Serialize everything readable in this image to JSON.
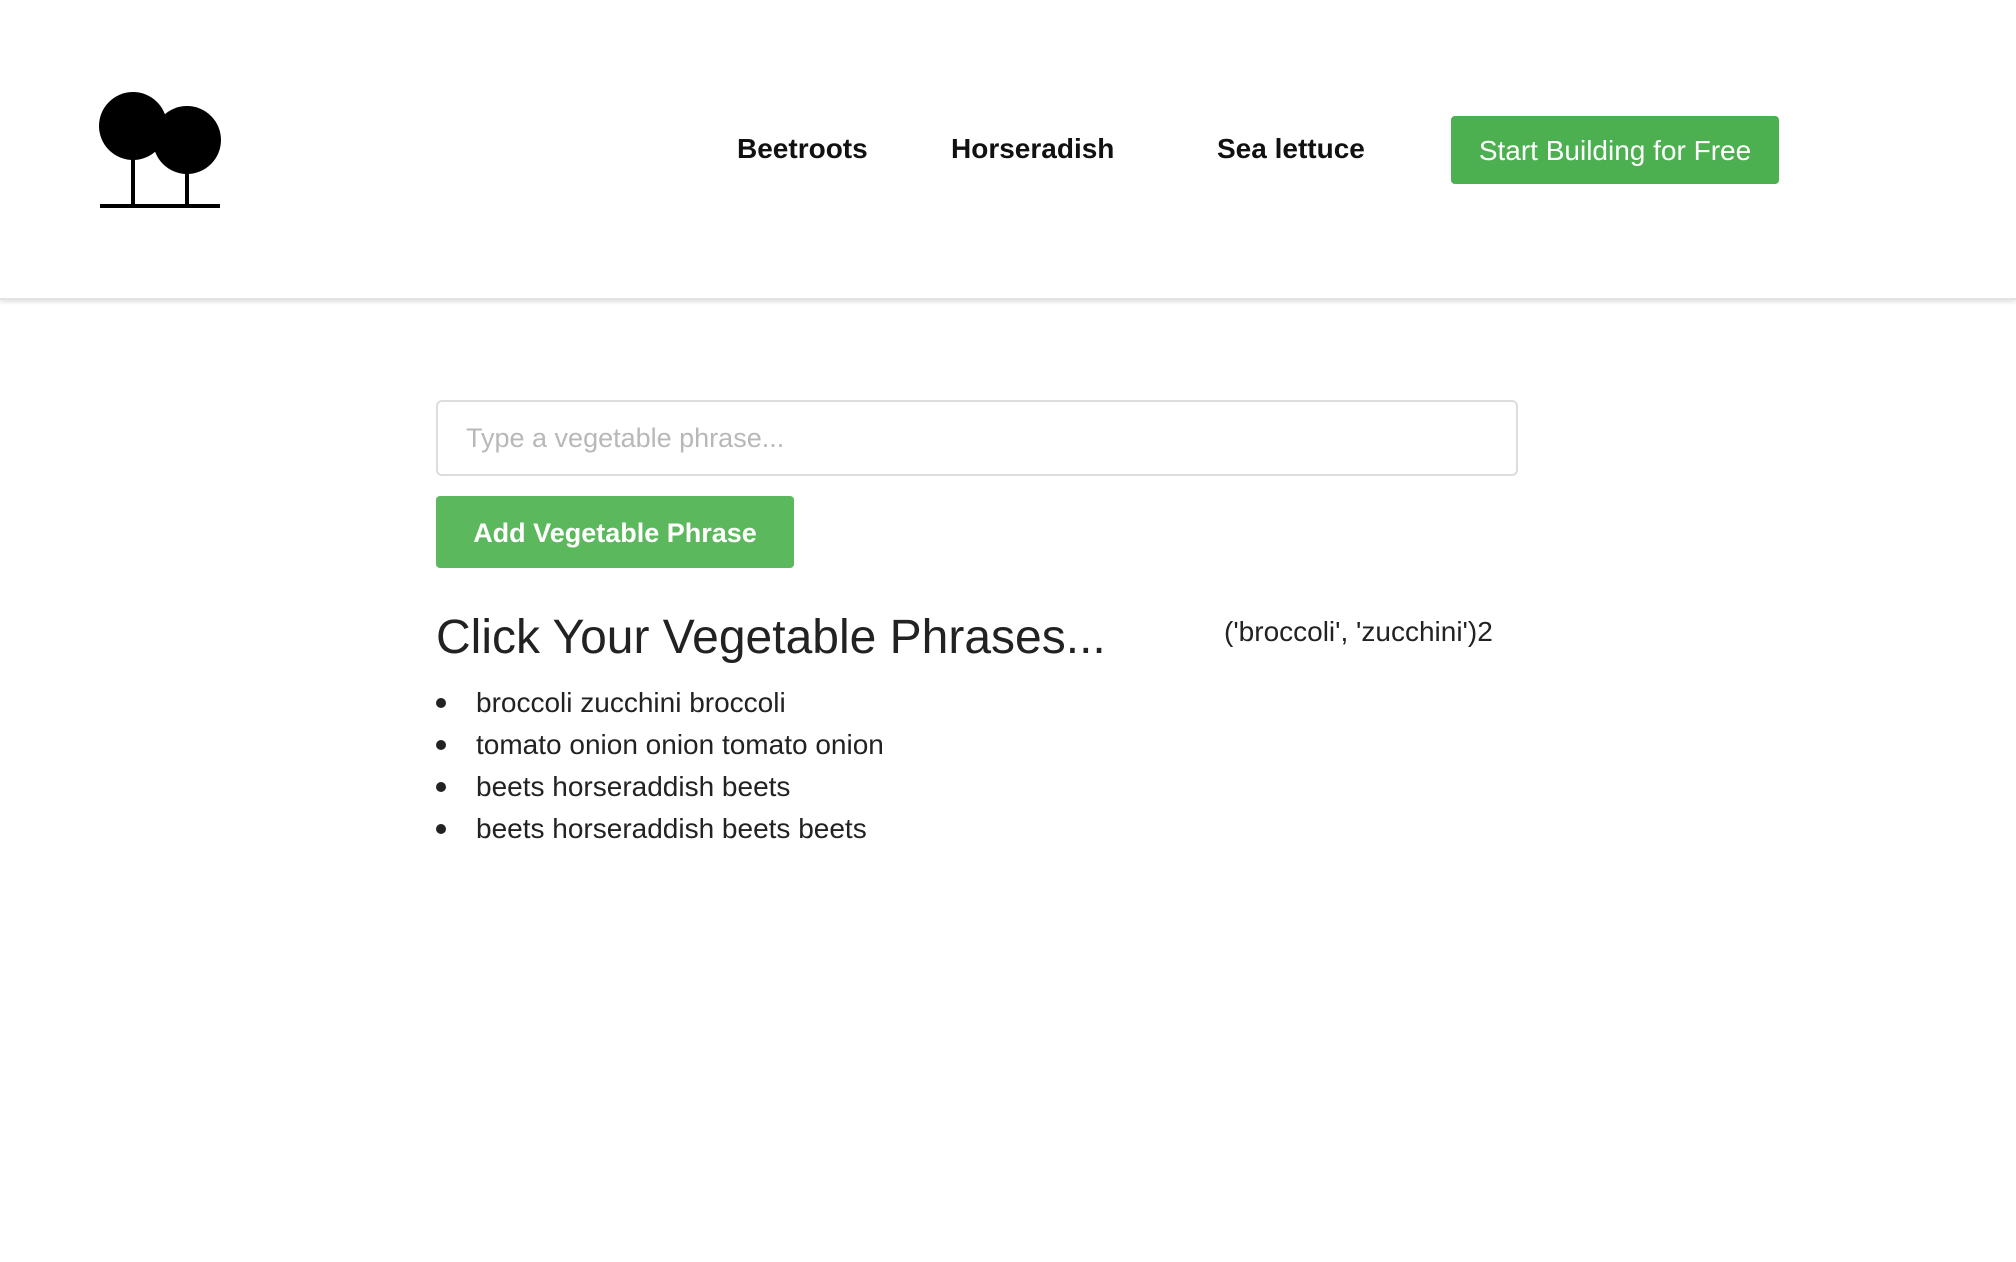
{
  "header": {
    "logo_icon": "two-trees-icon",
    "nav": {
      "beetroots": "Beetroots",
      "horseradish": "Horseradish",
      "sea_lettuce": "Sea lettuce"
    },
    "cta_label": "Start Building for Free",
    "cta_color": "#4caf50"
  },
  "form": {
    "input_value": "",
    "input_placeholder": "Type a vegetable phrase...",
    "add_button_label": "Add Vegetable Phrase",
    "add_button_color": "#5cb85c"
  },
  "phrases": {
    "heading": "Click Your Vegetable Phrases...",
    "tuple_text": "('broccoli', 'zucchini')2",
    "items": [
      "broccoli zucchini broccoli",
      "tomato onion onion tomato onion",
      "beets horseraddish beets",
      "beets horseraddish beets beets"
    ]
  }
}
